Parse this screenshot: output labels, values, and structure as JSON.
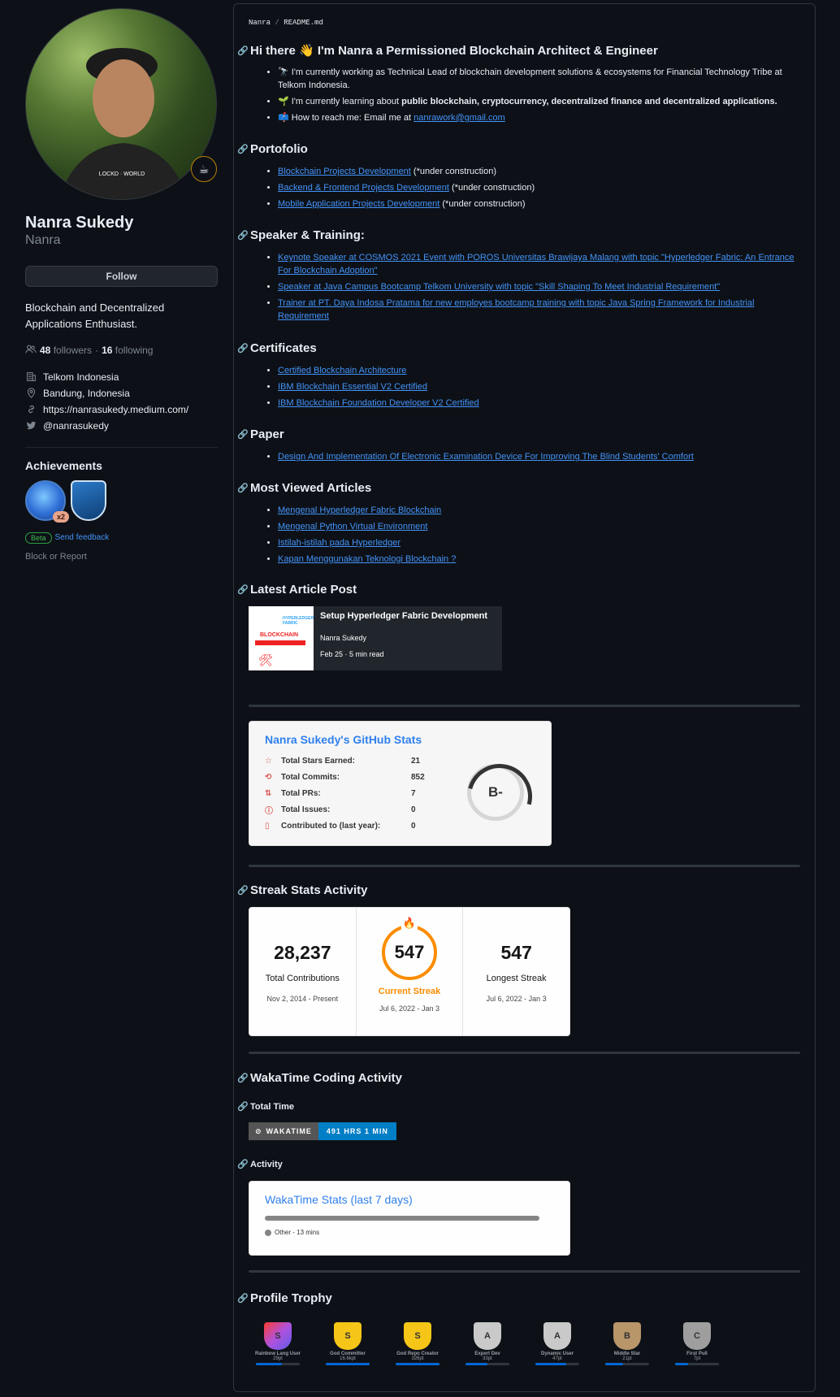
{
  "profile": {
    "name": "Nanra Sukedy",
    "login": "Nanra",
    "follow_label": "Follow",
    "bio": "Blockchain and Decentralized Applications Enthusiast.",
    "followers_count": "48",
    "followers_label": "followers",
    "dot": "·",
    "following_count": "16",
    "following_label": "following",
    "company": "Telkom Indonesia",
    "location": "Bandung, Indonesia",
    "website": "https://nanrasukedy.medium.com/",
    "twitter": "@nanrasukedy",
    "achievements_title": "Achievements",
    "badge_count": "x2",
    "beta_label": "Beta",
    "feedback_label": "Send feedback",
    "block_report": "Block or Report"
  },
  "readme": {
    "crumb_user": "Nanra",
    "crumb_sep": "/",
    "crumb_file": "README.md",
    "intro_title": "Hi there 👋 I'm Nanra a Permissioned Blockchain Architect & Engineer",
    "intro_items": [
      "🔭 I'm currently working as Technical Lead of blockchain development solutions & ecosystems for Financial Technology Tribe at Telkom Indonesia.",
      "🌱 I'm currently learning about ",
      "public blockchain, cryptocurrency, decentralized finance and decentralized applications.",
      "📫 How to reach me: Email me at ",
      "nanrawork@gmail.com"
    ],
    "portfolio_title": "Portofolio",
    "portfolio": [
      {
        "link": "Blockchain Projects Development",
        "note": " (*under construction)"
      },
      {
        "link": "Backend & Frontend Projects Development",
        "note": " (*under construction)"
      },
      {
        "link": "Mobile Application Projects Development",
        "note": " (*under construction)"
      }
    ],
    "speaker_title": "Speaker & Training:",
    "speaker": [
      "Keynote Speaker at COSMOS 2021 Event with POROS Universitas Brawijaya Malang with topic \"Hyperledger Fabric: An Entrance For Blockchain Adoption\"",
      "Speaker at Java Campus Bootcamp Telkom University with topic \"Skill Shaping To Meet Industrial Requirement\"",
      "Trainer at PT. Daya Indosa Pratama for new employes bootcamp training with topic Java Spring Framework for Industrial Requirement"
    ],
    "cert_title": "Certificates",
    "certs": [
      "Certified Blockchain Architecture",
      "IBM Blockchain Essential V2 Certified",
      "IBM Blockchain Foundation Developer V2 Certified"
    ],
    "paper_title": "Paper",
    "papers": [
      "Design And Implementation Of Electronic Examination Device For Improving The Blind Students' Comfort"
    ],
    "articles_title": "Most Viewed Articles",
    "articles": [
      "Mengenal Hyperledger Fabric Blockchain",
      "Mengenal Python Virtual Environment",
      "Istilah-istilah pada Hyperledger",
      "Kapan Menggunakan Teknologi Blockchain ?"
    ],
    "latest_title": "Latest Article Post",
    "latest": {
      "title": "Setup Hyperledger Fabric Development",
      "author": "Nanra Sukedy",
      "meta": "Feb 25 · 5 min read",
      "thumb_brand": "HYPERLEDGER FABRIC",
      "thumb_text": "BLOCKCHAIN"
    },
    "stats": {
      "title": "Nanra Sukedy's GitHub Stats",
      "rows": [
        {
          "label": "Total Stars Earned:",
          "value": "21"
        },
        {
          "label": "Total Commits:",
          "value": "852"
        },
        {
          "label": "Total PRs:",
          "value": "7"
        },
        {
          "label": "Total Issues:",
          "value": "0"
        },
        {
          "label": "Contributed to (last year):",
          "value": "0"
        }
      ],
      "rank": "B-"
    },
    "streak_title": "Streak Stats Activity",
    "streak": {
      "total": "28,237",
      "total_label": "Total Contributions",
      "total_range": "Nov 2, 2014 - Present",
      "current": "547",
      "current_label": "Current Streak",
      "current_range": "Jul 6, 2022 - Jan 3",
      "longest": "547",
      "longest_label": "Longest Streak",
      "longest_range": "Jul 6, 2022 - Jan 3"
    },
    "waka_title": "WakaTime Coding Activity",
    "total_time_title": "Total Time",
    "waka_badge_left": "WAKATIME",
    "waka_badge_right": "491 HRS 1 MIN",
    "activity_title": "Activity",
    "waka_card_title": "WakaTime Stats (last 7 days)",
    "waka_legend": "Other - 13 mins",
    "trophy_title": "Profile Trophy",
    "trophies": [
      {
        "rank": "S",
        "name": "Rainbow Lang User",
        "pts": "29pt",
        "fill": 0.6
      },
      {
        "rank": "S",
        "name": "God Committer",
        "pts": "16.6kpt",
        "fill": 1.0
      },
      {
        "rank": "S",
        "name": "God Repo Creator",
        "pts": "326pt",
        "fill": 1.0
      },
      {
        "rank": "A",
        "name": "Expert Dev",
        "pts": "33pt",
        "fill": 0.5
      },
      {
        "rank": "A",
        "name": "Dynamic User",
        "pts": "47pt",
        "fill": 0.7
      },
      {
        "rank": "B",
        "name": "Middle Star",
        "pts": "21pt",
        "fill": 0.4
      },
      {
        "rank": "C",
        "name": "First Pull",
        "pts": "7pt",
        "fill": 0.3
      }
    ]
  },
  "colors": {
    "bg": "#0d1117",
    "accent": "#4493f8",
    "streak": "#fb8c00",
    "waka_blue": "#007ec6"
  }
}
